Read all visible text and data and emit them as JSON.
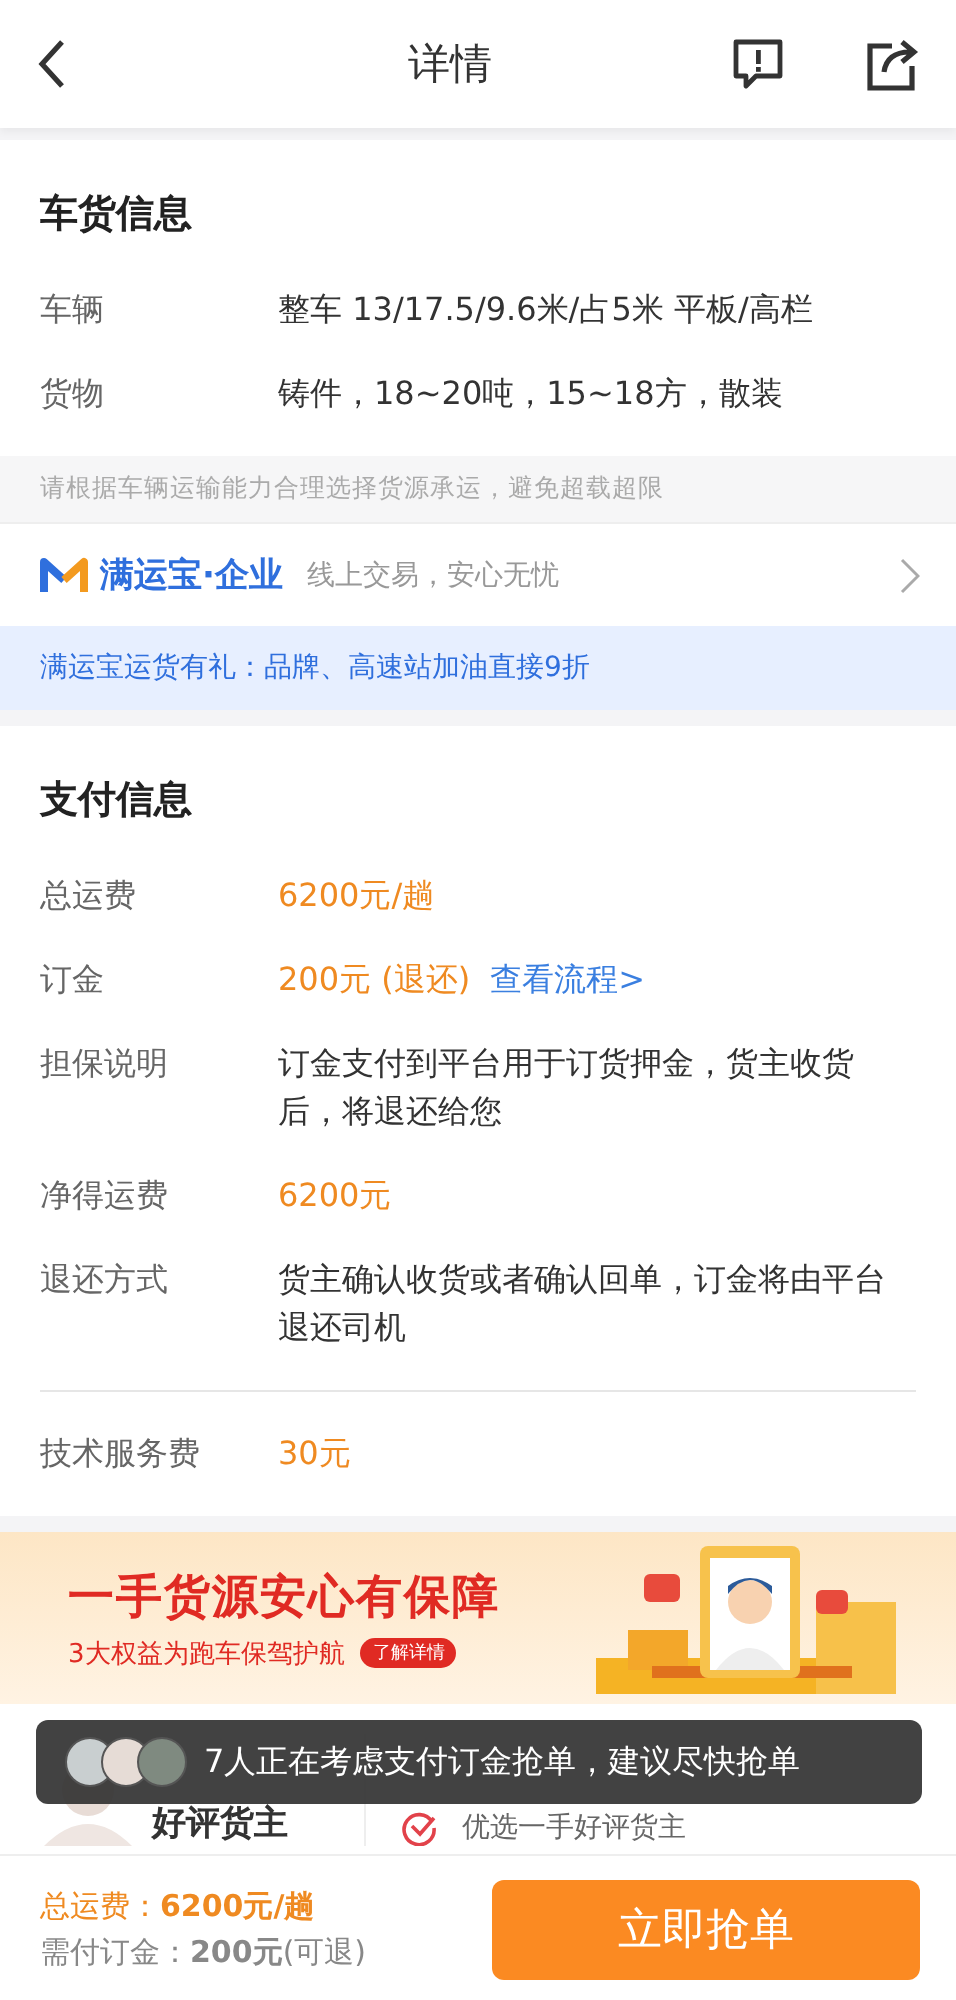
{
  "header": {
    "title": "详情"
  },
  "cargo_section": {
    "title": "车货信息",
    "rows": [
      {
        "label": "车辆",
        "value": "整车 13/17.5/9.6米/占5米 平板/高栏",
        "kind": "text"
      },
      {
        "label": "货物",
        "value": "铸件，18~20吨，15~18方，散装",
        "kind": "text"
      }
    ],
    "hint": "请根据车辆运输能力合理选择货源承运，避免超载超限"
  },
  "enterprise": {
    "brand": "满运宝·企业",
    "slogan": "线上交易，安心无忧"
  },
  "promo_bar": "满运宝运货有礼：品牌、高速站加油直接9折",
  "payment_section": {
    "title": "支付信息",
    "rows": [
      {
        "label": "总运费",
        "value": "6200元/趟",
        "kind": "amount"
      },
      {
        "label": "订金",
        "value": "200元 (退还)",
        "kind": "amount",
        "link": "查看流程>"
      },
      {
        "label": "担保说明",
        "value": "订金支付到平台用于订货押金，货主收货后，将退还给您",
        "kind": "text"
      },
      {
        "label": "净得运费",
        "value": "6200元",
        "kind": "amount"
      },
      {
        "label": "退还方式",
        "value": "货主确认收货或者确认回单，订金将由平台退还司机",
        "kind": "text"
      }
    ],
    "fee": {
      "label": "技术服务费",
      "value": "30元",
      "kind": "amount"
    }
  },
  "banner": {
    "headline": "一手货源安心有保障",
    "subline": "3大权益为跑车保驾护航",
    "badge": "了解详情"
  },
  "shipper": {
    "title": "好评货主",
    "feature": "优选一手好评货主"
  },
  "toast": {
    "text": "7人正在考虑支付订金抢单，建议尽快抢单"
  },
  "bottom_bar": {
    "total": "总运费：**6200元/趟**",
    "deposit": "需付订金：**200元**(可退)",
    "button": "立即抢单"
  }
}
